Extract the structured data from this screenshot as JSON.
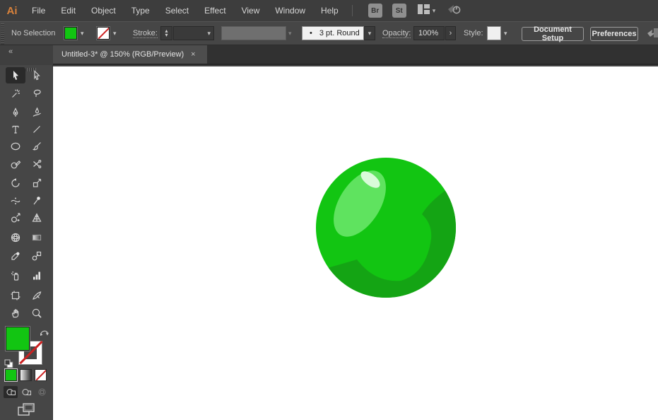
{
  "menubar": {
    "logo": "Ai",
    "items": [
      "File",
      "Edit",
      "Object",
      "Type",
      "Select",
      "Effect",
      "View",
      "Window",
      "Help"
    ],
    "bridge_label": "Br",
    "stock_label": "St",
    "right_icons": [
      "bridge-button",
      "stock-button",
      "workspace-switcher",
      "sync-power"
    ]
  },
  "controlbar": {
    "no_selection": "No Selection",
    "stroke_label": "Stroke:",
    "brush_bullet": "•",
    "brush_value": "3 pt. Round",
    "opacity_label": "Opacity:",
    "opacity_value": "100%",
    "opacity_arrow": "›",
    "style_label": "Style:",
    "document_setup_label": "Document Setup",
    "preferences_label": "Preferences",
    "fill_swatch_color": "#12C512",
    "stroke_swatch": "none"
  },
  "tabbar": {
    "active_tab_title": "Untitled-3* @ 150% (RGB/Preview)",
    "close_glyph": "×",
    "collapse_glyph": "«"
  },
  "toolbar": {
    "active_tool": "Selection",
    "tools": [
      "Selection",
      "Direct Selection",
      "Magic Wand",
      "Lasso",
      "Pen",
      "Curvature",
      "Type",
      "Line Segment",
      "Ellipse",
      "Paintbrush",
      "Shaper",
      "Scissors",
      "Rotate",
      "Scale",
      "Width",
      "Puppet Warp",
      "Shape Builder",
      "Perspective Grid",
      "Mesh",
      "Gradient",
      "Eyedropper",
      "Blend",
      "Symbol Sprayer",
      "Column Graph",
      "Artboard",
      "Slice",
      "Hand",
      "Zoom"
    ],
    "fill_color": "#12C512",
    "stroke_style": "none",
    "color_buttons": [
      "color",
      "gradient",
      "none"
    ],
    "drawing_modes": [
      "draw-normal",
      "draw-behind",
      "draw-inside"
    ],
    "screen_mode": "change-screen-mode"
  },
  "artwork": {
    "description": "green glossy ball illustration",
    "ball_color": "#12C512",
    "shadow_color": "#14A414",
    "highlight_color": "#5FE35F",
    "gloss_color": "#D9FBD9"
  }
}
